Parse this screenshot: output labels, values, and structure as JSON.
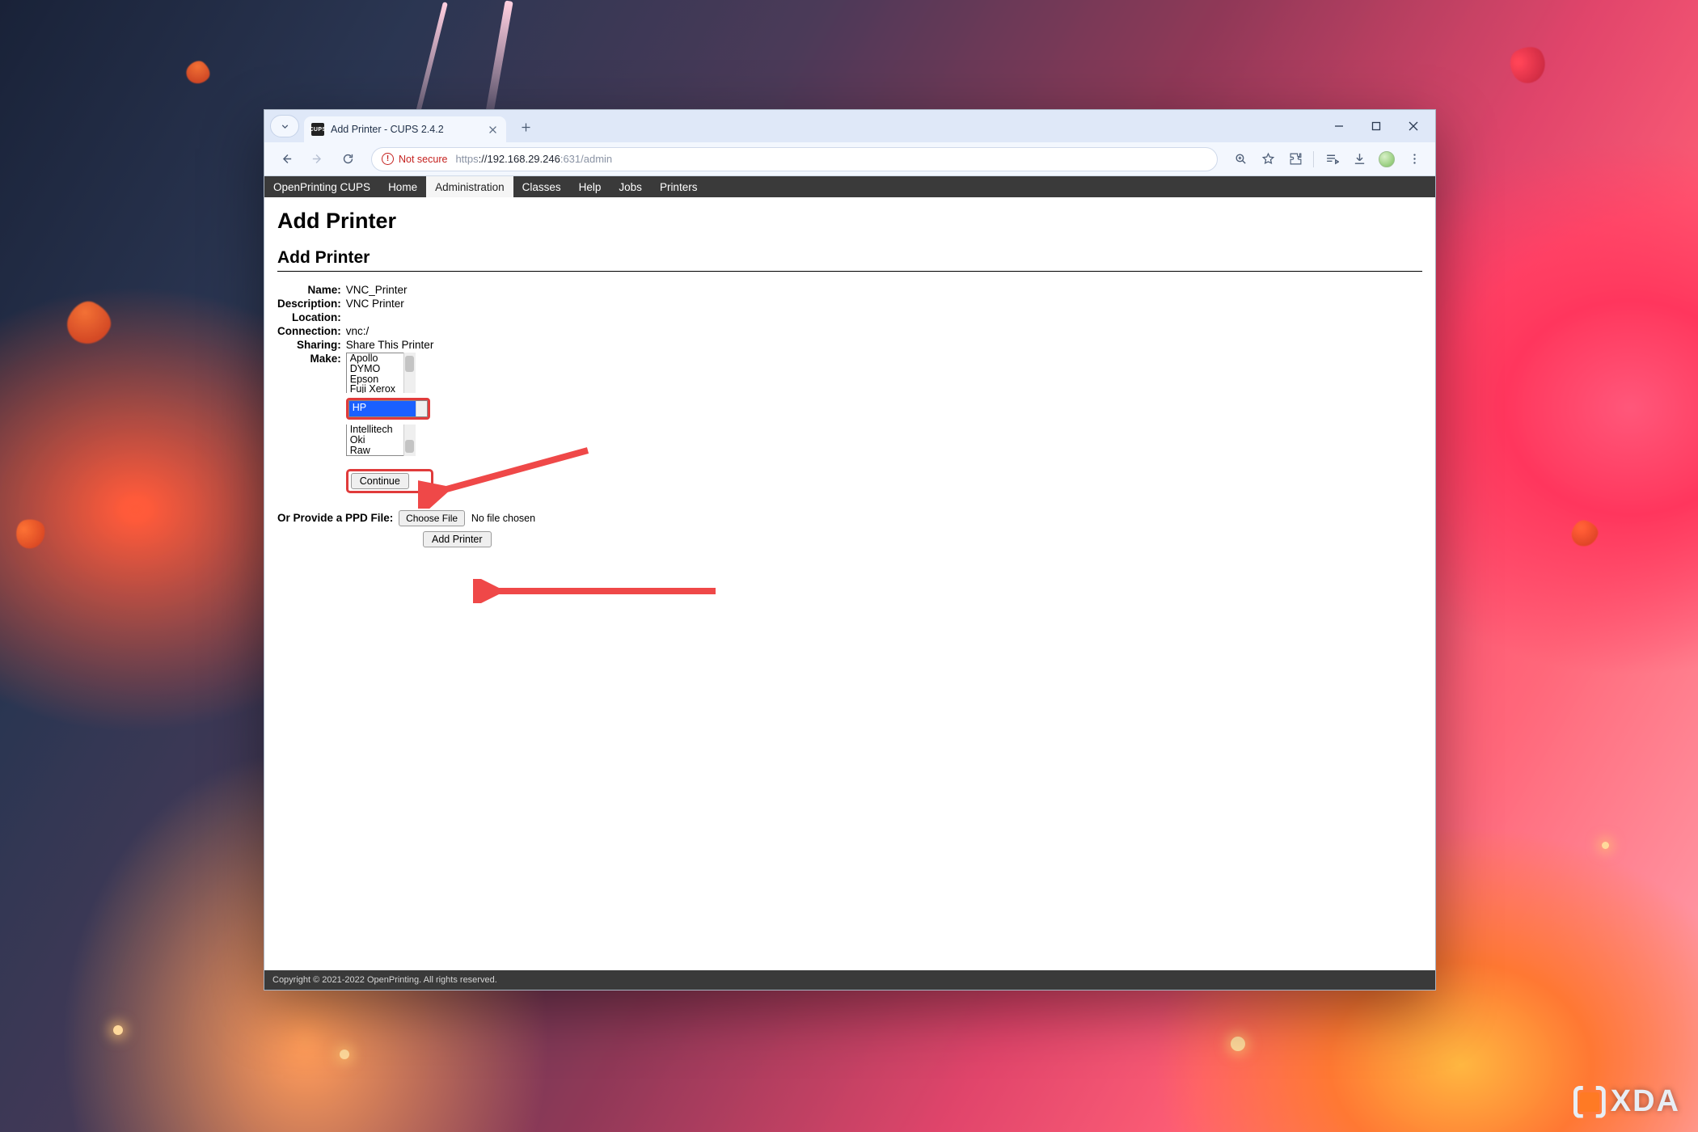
{
  "browser": {
    "tab_title": "Add Printer - CUPS 2.4.2",
    "favicon_text": "CUPS",
    "security_label": "Not secure",
    "url_https": "https",
    "url_host": "://192.168.29.246",
    "url_path": ":631/admin"
  },
  "nav": {
    "brand": "OpenPrinting CUPS",
    "items": [
      "Home",
      "Administration",
      "Classes",
      "Help",
      "Jobs",
      "Printers"
    ],
    "active_index": 1
  },
  "page": {
    "h1": "Add Printer",
    "h2": "Add Printer",
    "fields": {
      "name_label": "Name:",
      "name_value": "VNC_Printer",
      "description_label": "Description:",
      "description_value": "VNC Printer",
      "location_label": "Location:",
      "location_value": "",
      "connection_label": "Connection:",
      "connection_value": "vnc:/",
      "sharing_label": "Sharing:",
      "sharing_value": "Share This Printer",
      "make_label": "Make:"
    },
    "make_options_top": [
      "Apollo",
      "DYMO",
      "Epson",
      "Fuji Xerox"
    ],
    "make_selected": "HP",
    "make_options_bottom": [
      "Intellitech",
      "Oki",
      "Raw"
    ],
    "continue_label": "Continue",
    "ppd_label": "Or Provide a PPD File:",
    "choose_file_label": "Choose File",
    "no_file_label": "No file chosen",
    "add_printer_label": "Add Printer"
  },
  "footer": {
    "text": "Copyright © 2021-2022 OpenPrinting. All rights reserved."
  },
  "watermark": {
    "text": "XDA"
  }
}
